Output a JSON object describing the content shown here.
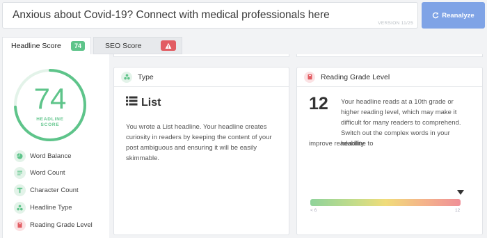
{
  "headline": {
    "text": "Anxious about Covid-19? Connect with medical professionals here",
    "version": "VERSION 11/25"
  },
  "reanalyze_button": {
    "label": "Reanalyze",
    "icon": "refresh-icon"
  },
  "tabs": [
    {
      "label": "Headline Score",
      "badge": "74",
      "active": true
    },
    {
      "label": "SEO Score",
      "badge_icon": "warning-icon",
      "active": false
    }
  ],
  "score": {
    "value": "74",
    "caption_line1": "HEADLINE",
    "caption_line2": "SCORE",
    "fraction": 0.74
  },
  "sidebar": {
    "items": [
      {
        "label": "Word Balance",
        "icon": "word-balance-icon"
      },
      {
        "label": "Word Count",
        "icon": "word-count-icon"
      },
      {
        "label": "Character Count",
        "icon": "character-count-icon"
      },
      {
        "label": "Headline Type",
        "icon": "headline-type-icon"
      },
      {
        "label": "Reading Grade Level",
        "icon": "reading-grade-icon"
      }
    ]
  },
  "type_card": {
    "title": "Type",
    "list_label": "List",
    "description": "You wrote a List headline. Your headline creates curiosity in readers by keeping the content of your post ambiguous and ensuring it will be easily skimmable."
  },
  "grade_card": {
    "title": "Reading Grade Level",
    "grade": "12",
    "description": "Your headline reads at a 10th grade or higher reading level, which may make it difficult for many readers to comprehend. Switch out the complex words in your headline to",
    "description_tail": "improve readability.",
    "scale_min": "< 6",
    "scale_max": "12",
    "marker_fraction": 1.0
  },
  "colors": {
    "accent_green": "#5ec48a",
    "warning_red": "#e25c62",
    "button_blue": "#7fa3e6"
  }
}
